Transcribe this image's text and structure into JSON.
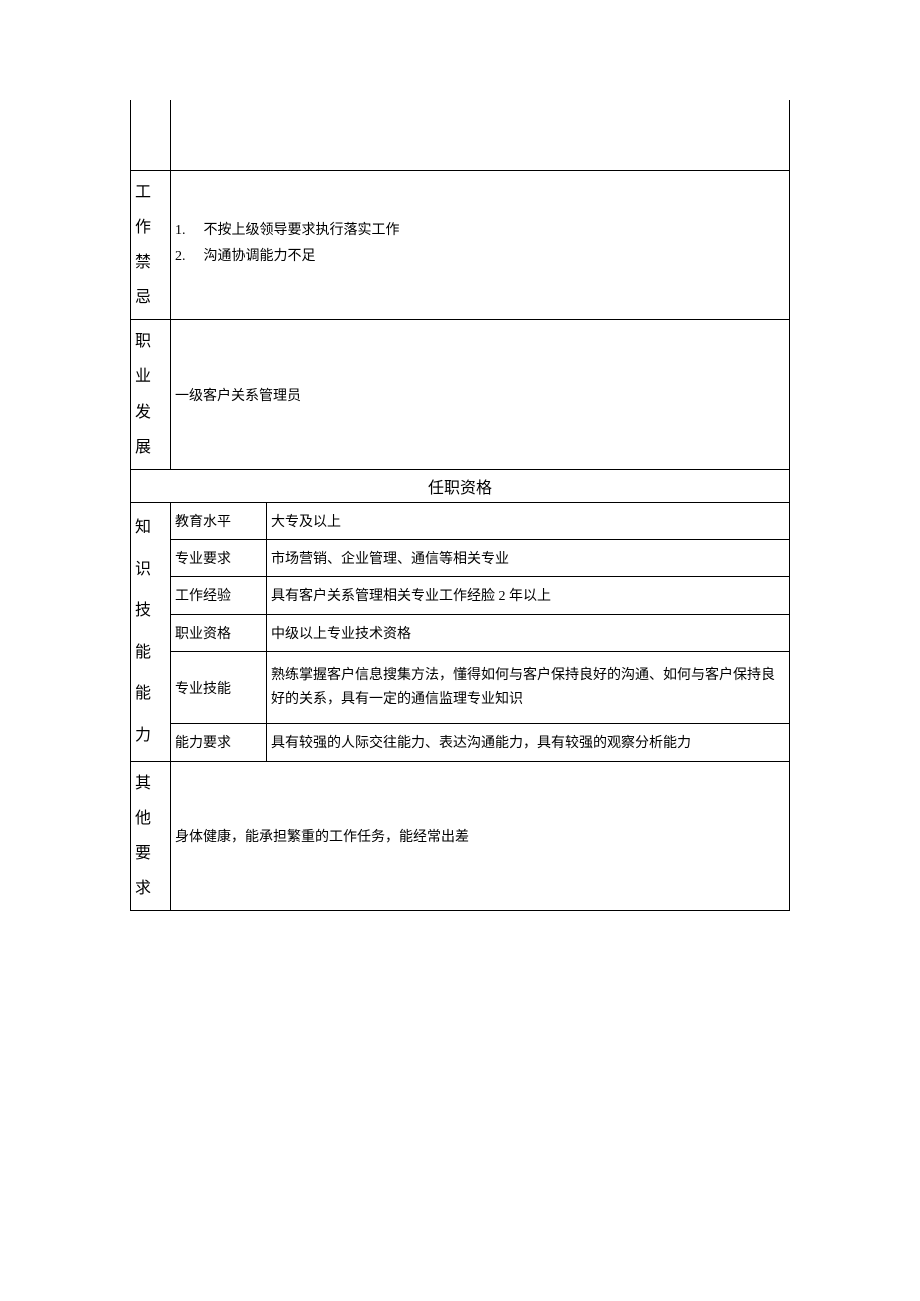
{
  "sections": {
    "empty_top_label": "",
    "work_taboo": {
      "label": "工 作禁忌",
      "items": [
        {
          "num": "1.",
          "text": "不按上级领导要求执行落实工作"
        },
        {
          "num": "2.",
          "text": "沟通协调能力不足"
        }
      ]
    },
    "career": {
      "label_chars": [
        "职",
        "业",
        "发",
        "展"
      ],
      "content": "一级客户关系管理员"
    },
    "qualification_header": "任职资格",
    "ksa": {
      "label_chars": [
        "知 识",
        "技 能",
        "能力"
      ],
      "rows": {
        "education": {
          "label": "教育水平",
          "value": "大专及以上"
        },
        "major": {
          "label": "专业要求",
          "value": "市场营销、企业管理、通信等相关专业"
        },
        "experience": {
          "label": "工作经验",
          "value": "具有客户关系管理相关专业工作经脸 2 年以上"
        },
        "cert": {
          "label": "职业资格",
          "value": "中级以上专业技术资格"
        },
        "skill": {
          "label": "专业技能",
          "value": "熟练掌握客户信息搜集方法，懂得如何与客户保持良好的沟通、如何与客户保持良好的关系，具有一定的通信监理专业知识"
        },
        "ability": {
          "label": "能力要求",
          "value": "具有较强的人际交往能力、表达沟通能力，具有较强的观察分析能力"
        }
      }
    },
    "other": {
      "label_chars": [
        "其",
        "他",
        "要",
        "求"
      ],
      "content": "身体健康，能承担繁重的工作任务，能经常出差"
    }
  }
}
